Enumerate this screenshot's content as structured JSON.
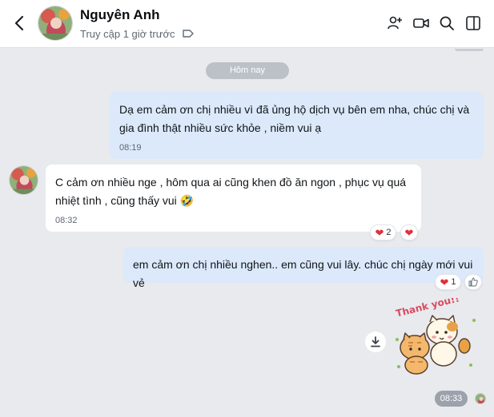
{
  "header": {
    "contact_name": "Nguyên Anh",
    "status": "Truy cập 1 giờ trước",
    "icons": [
      "back-arrow-icon",
      "add-member-icon",
      "video-call-icon",
      "search-icon",
      "sidebar-toggle-icon",
      "tag-icon"
    ]
  },
  "chat": {
    "date_divider": "Hôm nay",
    "messages": [
      {
        "direction": "out",
        "text": "Dạ em cảm ơn chị nhiều vì đã ủng hộ dịch vụ bên em nha, chúc chị và gia đình thật nhiều sức khỏe , niềm vui ạ",
        "time": "08:19"
      },
      {
        "direction": "in",
        "text": "C cảm ơn nhiều nge , hôm qua ai cũng khen đồ ăn ngon , phục vụ quá nhiệt tình , cũng thấy vui 🤣",
        "time": "08:32",
        "reactions": {
          "count": "2",
          "icon": "heart-icon"
        }
      },
      {
        "direction": "out",
        "text": "em cảm ơn chị nhiều nghen.. em cũng vui lây. chúc chị ngày mới vui vẻ",
        "reactions": {
          "count": "1",
          "icon": "heart-icon"
        }
      }
    ],
    "sticker": {
      "text": "Thank you!!",
      "icon": "cats-thank-you-sticker"
    },
    "last_time": "08:33"
  },
  "colors": {
    "chat_background": "#e8eaee",
    "outgoing_bubble": "#dbe9fb",
    "incoming_bubble": "#ffffff",
    "heart": "#e0303c"
  }
}
